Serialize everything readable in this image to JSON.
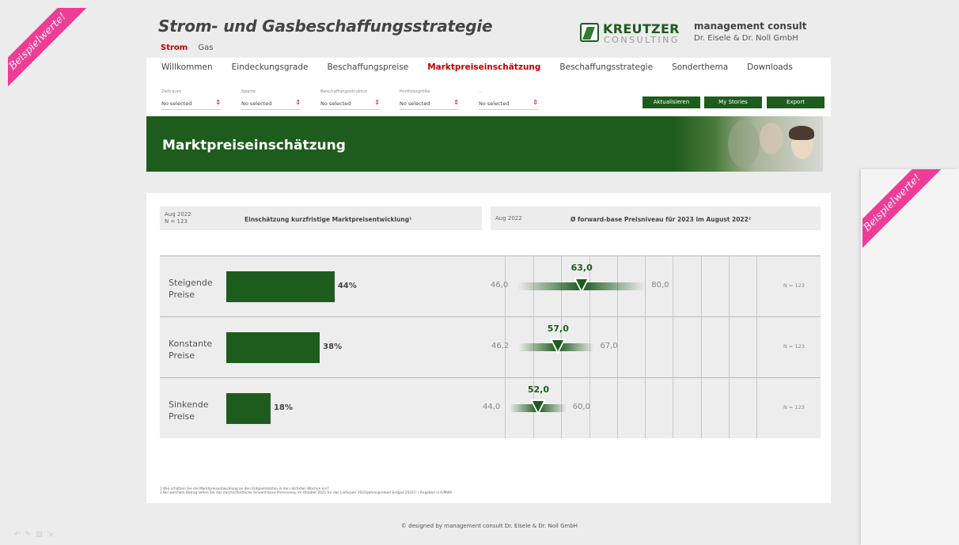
{
  "ribbon": {
    "text": "Beispielwerte!"
  },
  "header": {
    "title": "Strom- und Gasbeschaffungsstrategie",
    "commodities": [
      "Strom",
      "Gas"
    ],
    "logo_name": "KREUTZER",
    "logo_sub": "CONSULTING",
    "company_name": "management consult",
    "company_sub": "Dr. Eisele & Dr. Noll GmbH"
  },
  "nav": {
    "items": [
      "Willkommen",
      "Eindeckungsgrade",
      "Beschaffungspreise",
      "Marktpreiseinschätzung",
      "Beschaffungsstrategie",
      "Sonderthema",
      "Downloads"
    ],
    "active": "Marktpreiseinschätzung"
  },
  "filters": [
    {
      "label": "Zeitraum",
      "value": "No selected"
    },
    {
      "label": "Sparte",
      "value": "No selected"
    },
    {
      "label": "Beschaffungsstruktur",
      "value": "No selected"
    },
    {
      "label": "Portfoliogröße",
      "value": "No selected"
    },
    {
      "label": "...",
      "value": "No selected"
    }
  ],
  "buttons": {
    "refresh": "Aktualisieren",
    "stories": "My Stories",
    "export": "Export"
  },
  "banner": {
    "title": "Marktpreiseinschätzung"
  },
  "left_panel": {
    "date": "Aug 2022",
    "n": "N = 123",
    "title": "Einschätzung kurzfristige Marktpreisentwicklung¹"
  },
  "right_panel": {
    "date": "Aug 2022",
    "title": "Ø forward-base Preisniveau für 2023 im August 2022²"
  },
  "rows": [
    {
      "label_1": "Steigende",
      "label_2": "Preise",
      "share": 44,
      "share_label": "44%",
      "min": 46.0,
      "mean": 63.0,
      "max": 80.0,
      "min_label": "46,0",
      "mean_label": "63,0",
      "max_label": "80,0",
      "n_label": "N = 123"
    },
    {
      "label_1": "Konstante",
      "label_2": "Preise",
      "share": 38,
      "share_label": "38%",
      "min": 46.2,
      "mean": 57.0,
      "max": 67.0,
      "min_label": "46,2",
      "mean_label": "57,0",
      "max_label": "67,0",
      "n_label": "N = 123"
    },
    {
      "label_1": "Sinkende",
      "label_2": "Preise",
      "share": 18,
      "share_label": "18%",
      "min": 44.0,
      "mean": 52.0,
      "max": 60.0,
      "min_label": "44,0",
      "mean_label": "52,0",
      "max_label": "60,0",
      "n_label": "N = 123"
    }
  ],
  "footnotes": [
    "1 Wie schätzen Sie die Marktpreisentwicklung an den Erdgasmärkten in den nächsten Wochen ein?",
    "2 Bei welchem Betrag sehen Sie das durchschnittliche forward-base Preisniveau im Oktober 2021 für das Lieferjahr 2022(Jahresprodukt Erdgas 2022)? / Angaben in €/MWh"
  ],
  "footer": "© designed by management consult Dr. Eisele & Dr. Noll GmbH",
  "colors": {
    "accent_green": "#1e5c1e",
    "active_red": "#c00000",
    "ribbon_pink": "#ee3d96"
  }
}
